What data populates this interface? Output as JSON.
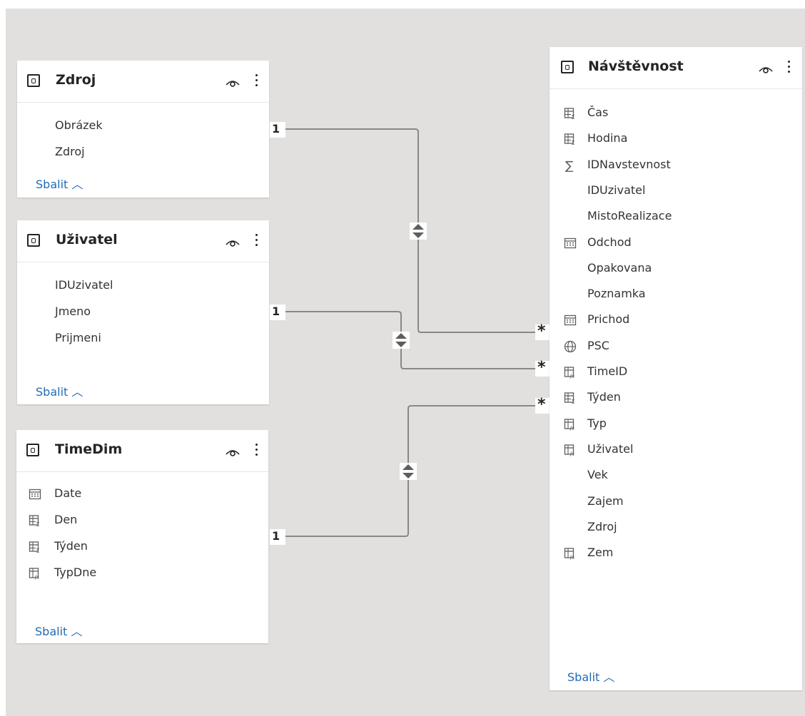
{
  "tables": {
    "zdroj": {
      "title": "Zdroj",
      "fields": [
        "Obrázek",
        "Zdroj"
      ],
      "collapse": "Sbalit ︿"
    },
    "uzivatel": {
      "title": "Uživatel",
      "fields": [
        "IDUzivatel",
        "Jmeno",
        "Prijmeni"
      ],
      "collapse": "Sbalit ︿"
    },
    "timedim": {
      "title": "TimeDim",
      "fields": [
        {
          "name": "Date",
          "icon": "calendar-icon"
        },
        {
          "name": "Den",
          "icon": "table-sigma-icon"
        },
        {
          "name": "Týden",
          "icon": "table-sigma-icon"
        },
        {
          "name": "TypDne",
          "icon": "table-fx-icon"
        }
      ],
      "collapse": "Sbalit ︿"
    },
    "navstevnost": {
      "title": "Návštěvnost",
      "fields": [
        {
          "name": "Čas",
          "icon": "table-sigma-icon"
        },
        {
          "name": "Hodina",
          "icon": "table-sigma-icon"
        },
        {
          "name": "IDNavstevnost",
          "icon": "sigma-icon"
        },
        {
          "name": "IDUzivatel",
          "icon": ""
        },
        {
          "name": "MistoRealizace",
          "icon": ""
        },
        {
          "name": "Odchod",
          "icon": "calendar-icon"
        },
        {
          "name": "Opakovana",
          "icon": ""
        },
        {
          "name": "Poznamka",
          "icon": ""
        },
        {
          "name": "Prichod",
          "icon": "calendar-icon"
        },
        {
          "name": "PSC",
          "icon": "globe-icon"
        },
        {
          "name": "TimeID",
          "icon": "table-fx-icon"
        },
        {
          "name": "Týden",
          "icon": "table-sigma-icon"
        },
        {
          "name": "Typ",
          "icon": "table-fx-icon"
        },
        {
          "name": "Uživatel",
          "icon": "table-fx-icon"
        },
        {
          "name": "Vek",
          "icon": ""
        },
        {
          "name": "Zajem",
          "icon": ""
        },
        {
          "name": "Zdroj",
          "icon": ""
        },
        {
          "name": "Zem",
          "icon": "table-fx-icon"
        }
      ],
      "collapse": "Sbalit ︿"
    }
  },
  "relationships": [
    {
      "from": "Zdroj",
      "to": "Návštěvnost",
      "from_card": "1",
      "to_card": "*",
      "direction": "both"
    },
    {
      "from": "Uživatel",
      "to": "Návštěvnost",
      "from_card": "1",
      "to_card": "*",
      "direction": "both"
    },
    {
      "from": "TimeDim",
      "to": "Návštěvnost",
      "from_card": "1",
      "to_card": "*",
      "direction": "both"
    }
  ]
}
